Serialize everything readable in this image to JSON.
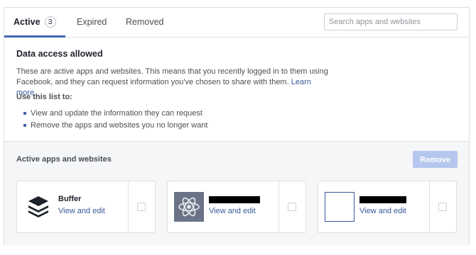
{
  "tabs": [
    {
      "label": "Active",
      "count": "3"
    },
    {
      "label": "Expired"
    },
    {
      "label": "Removed"
    }
  ],
  "search": {
    "placeholder": "Search apps and websites"
  },
  "allowed": {
    "heading": "Data access allowed",
    "description": "These are active apps and websites. This means that you recently logged in to them using Facebook, and they can request information you've chosen to share with them.",
    "learn_more": "Learn more",
    "use_label": "Use this list to:",
    "bullets": [
      "View and update the information they can request",
      "Remove the apps and websites you no longer want"
    ]
  },
  "active_section": {
    "title": "Active apps and websites",
    "remove_label": "Remove",
    "apps": [
      {
        "name": "Buffer",
        "link": "View and edit",
        "icon": "buffer-stack-icon"
      },
      {
        "name": "",
        "link": "View and edit",
        "icon": "atom-icon"
      },
      {
        "name": "",
        "link": "View and edit",
        "icon": "blank-app-icon"
      }
    ]
  },
  "colors": {
    "accent": "#4267b2",
    "link": "#365899",
    "remove_disabled": "#b5c7ee"
  }
}
